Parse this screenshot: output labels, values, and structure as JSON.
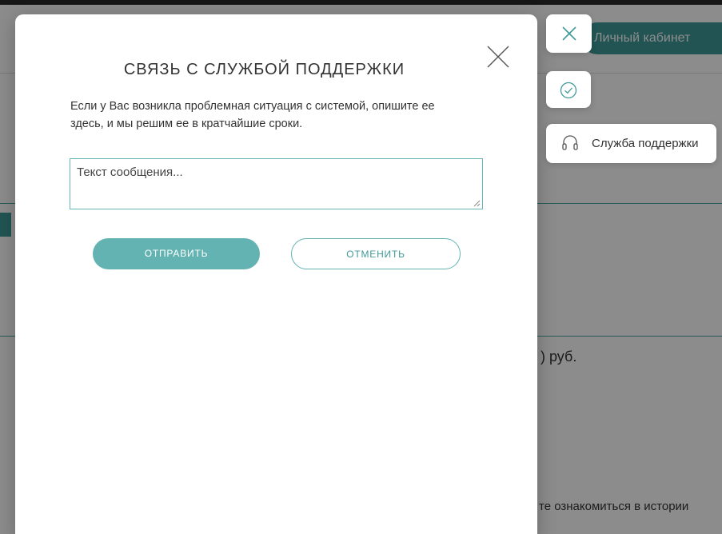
{
  "background": {
    "cabinet_button": "Личный кабинет",
    "price_fragment": ") руб.",
    "history_fragment": "те ознакомиться в истории"
  },
  "modal": {
    "title": "СВЯЗЬ С СЛУЖБОЙ ПОДДЕРЖКИ",
    "description": "Если у Вас возникла проблемная ситуация с системой, опишите ее здесь, и мы решим ее в кратчайшие сроки.",
    "message_placeholder": "Текст сообщения...",
    "send_label": "ОТПРАВИТЬ",
    "cancel_label": "ОТМЕНИТЬ",
    "close_icon": "close-icon"
  },
  "side_widgets": {
    "close_icon": "close-icon",
    "check_icon": "check-circle-icon",
    "support_icon": "headset-icon",
    "support_label": "Служба поддержки"
  },
  "colors": {
    "accent": "#63b3b2",
    "accent_dark": "#3f9a99",
    "overlay": "rgba(0,0,0,0.45)"
  }
}
